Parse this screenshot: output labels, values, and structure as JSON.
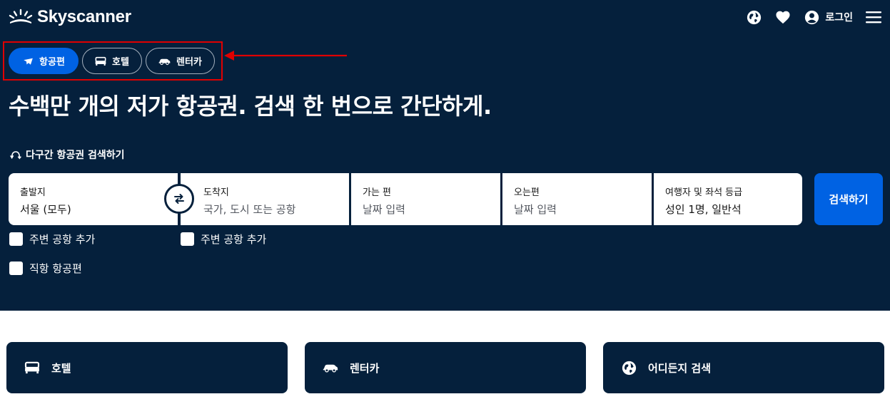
{
  "brand": {
    "name": "Skyscanner"
  },
  "header": {
    "globe_icon": "globe-icon",
    "heart_icon": "heart-icon",
    "login_label": "로그인",
    "menu_icon": "hamburger-menu-icon"
  },
  "tabs": [
    {
      "label": "항공편",
      "icon": "plane-icon",
      "active": true
    },
    {
      "label": "호텔",
      "icon": "bed-icon",
      "active": false
    },
    {
      "label": "렌터카",
      "icon": "car-icon",
      "active": false
    }
  ],
  "headline": "수백만 개의 저가 항공권. 검색 한 번으로 간단하게.",
  "multicity_label": "다구간 항공권 검색하기",
  "search": {
    "from": {
      "label": "출발지",
      "value": "서울 (모두)"
    },
    "to": {
      "label": "도착지",
      "placeholder": "국가, 도시 또는 공항"
    },
    "depart": {
      "label": "가는 편",
      "placeholder": "날짜 입력"
    },
    "return": {
      "label": "오는편",
      "placeholder": "날짜 입력"
    },
    "travellers": {
      "label": "여행자 및 좌석 등급",
      "value": "성인 1명, 일반석"
    },
    "button_label": "검색하기"
  },
  "checkboxes": {
    "nearby_from": "주변 공항 추가",
    "nearby_to": "주변 공항 추가",
    "direct": "직항 항공편"
  },
  "cards": [
    {
      "label": "호텔",
      "icon": "bed-icon"
    },
    {
      "label": "렌터카",
      "icon": "car-icon"
    },
    {
      "label": "어디든지 검색",
      "icon": "globe-icon"
    }
  ],
  "colors": {
    "navy": "#05203c",
    "accent_blue": "#0062e3",
    "annotation_red": "#e00000"
  }
}
